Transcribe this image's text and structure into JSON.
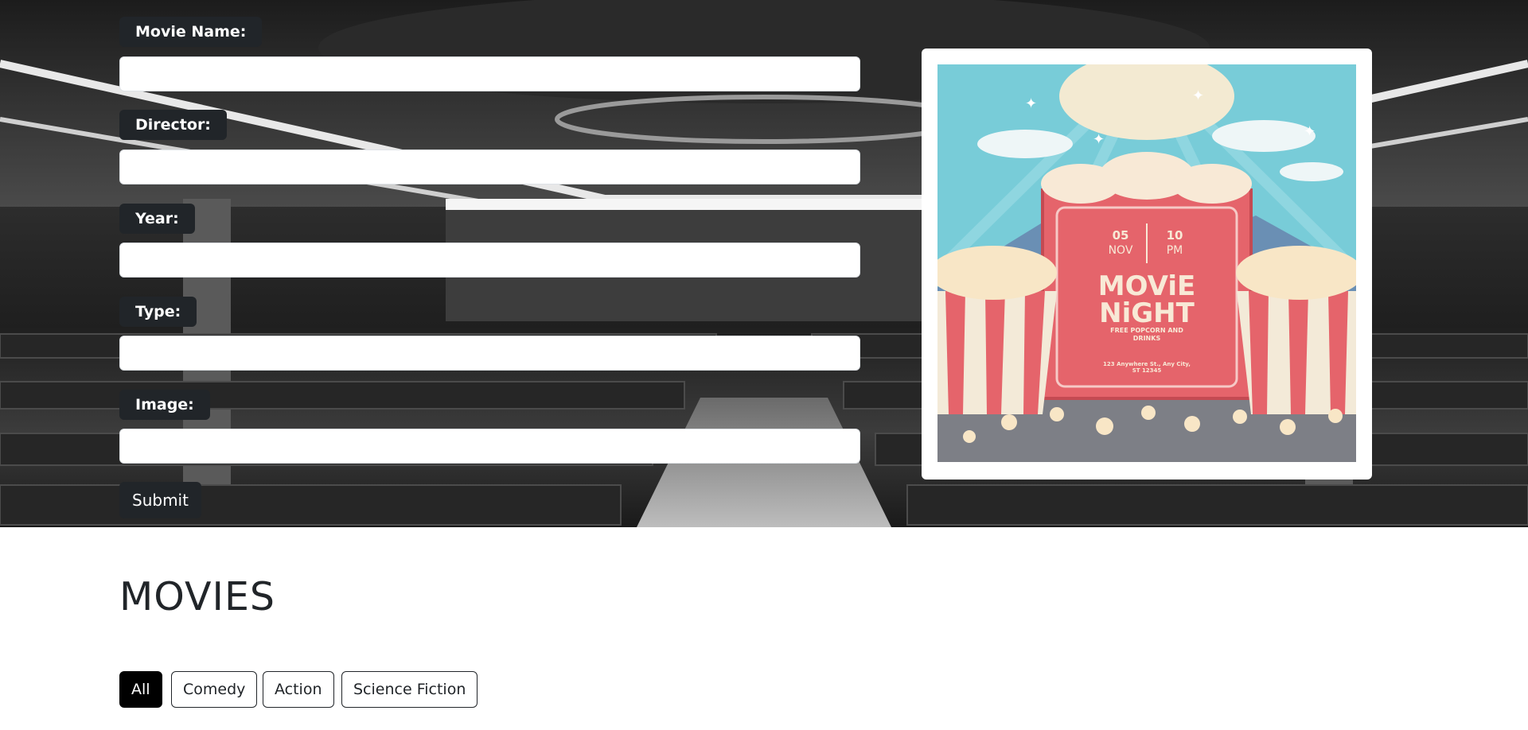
{
  "form": {
    "fields": [
      {
        "label": "Movie Name:",
        "value": "",
        "placeholder": ""
      },
      {
        "label": "Director:",
        "value": "",
        "placeholder": ""
      },
      {
        "label": "Year:",
        "value": "",
        "placeholder": ""
      },
      {
        "label": "Type:",
        "value": "",
        "placeholder": ""
      },
      {
        "label": "Image:",
        "value": "",
        "placeholder": ""
      }
    ],
    "submit_label": "Submit"
  },
  "poster": {
    "day": "05",
    "month": "NOV",
    "hour": "10",
    "ampm": "PM",
    "title_line1": "MOViE",
    "title_line2": "NiGHT",
    "tagline_line1": "FREE POPCORN AND",
    "tagline_line2": "DRINKS",
    "address_line1": "123 Anywhere St., Any City,",
    "address_line2": "ST 12345"
  },
  "movies": {
    "heading": "MOVIES",
    "filters": [
      "All",
      "Comedy",
      "Action",
      "Science Fiction"
    ],
    "active_filter": "All"
  },
  "colors": {
    "dark": "#212529",
    "active_filter": "#000000",
    "poster_sky": "#78ccd8",
    "poster_red": "#e5646b"
  }
}
